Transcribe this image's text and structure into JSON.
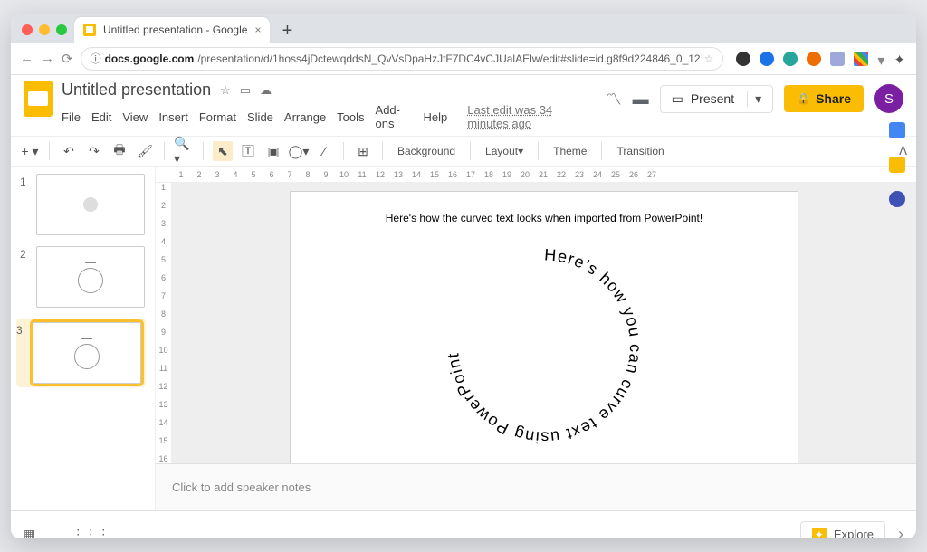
{
  "browser": {
    "tab_title": "Untitled presentation - Google",
    "url_host": "docs.google.com",
    "url_path": "/presentation/d/1hoss4jDctewqddsN_QvVsDpaHzJtF7DC4vCJUalAElw/edit#slide=id.g8f9d224846_0_12"
  },
  "doc": {
    "title": "Untitled presentation",
    "status": "Last edit was 34 minutes ago"
  },
  "menus": [
    "File",
    "Edit",
    "View",
    "Insert",
    "Format",
    "Slide",
    "Arrange",
    "Tools",
    "Add-ons",
    "Help"
  ],
  "header": {
    "present": "Present",
    "share": "Share",
    "avatar_letter": "S"
  },
  "toolbar": {
    "background": "Background",
    "layout": "Layout",
    "theme": "Theme",
    "transition": "Transition"
  },
  "slides": [
    {
      "num": "1",
      "kind": "blank"
    },
    {
      "num": "2",
      "kind": "mini"
    },
    {
      "num": "3",
      "kind": "mini",
      "selected": true
    }
  ],
  "slide": {
    "heading": "Here's how the curved text looks when imported from PowerPoint!",
    "curved_text": "Here's how you can curve text using PowerPoint"
  },
  "notes_placeholder": "Click to add speaker notes",
  "explore": "Explore"
}
